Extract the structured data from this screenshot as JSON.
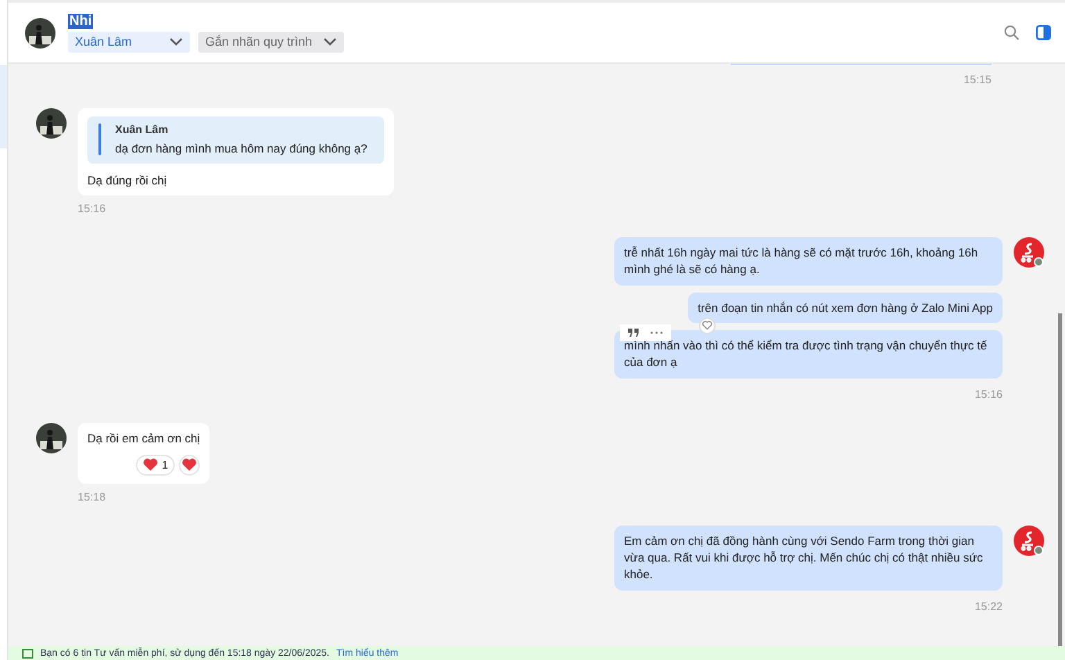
{
  "header": {
    "name": "Nhi",
    "assignee": "Xuân Lâm",
    "tag_placeholder": "Gắn nhãn quy trình"
  },
  "messages": [
    {
      "kind": "partial",
      "time": "15:15"
    },
    {
      "kind": "incoming",
      "quote": {
        "author": "Xuân Lâm",
        "text": "dạ đơn hàng mình mua hôm nay đúng không ạ?"
      },
      "bubbles": [
        "Dạ đúng rồi chị"
      ],
      "time": "15:16"
    },
    {
      "kind": "outgoing",
      "bubbles": [
        "trễ nhất 16h ngày mai tức là hàng sẽ có mặt trước 16h, khoảng 16h mình ghé là sẽ có hàng ạ.",
        "trên đoạn tin nhắn có nút xem đơn hàng ở Zalo Mini App",
        "mình nhấn vào thì có thể kiểm tra được tình trạng vận chuyển thực tế của đơn ạ"
      ],
      "time": "15:16"
    },
    {
      "kind": "incoming",
      "bubbles": [
        "Dạ rồi em cảm ơn chị"
      ],
      "reaction_count": "1",
      "time": "15:18"
    },
    {
      "kind": "outgoing",
      "bubbles": [
        "Em cảm ơn chị đã đồng hành cùng với Sendo Farm trong thời gian vừa qua. Rất vui khi được hỗ trợ chị. Mến chúc chị có thật nhiều sức khỏe."
      ],
      "time": "15:22"
    }
  ],
  "banner": {
    "text": "Bạn có 6 tin Tư vấn miễn phí, sử dụng đến 15:18 ngày 22/06/2025.",
    "link": "Tìm hiểu thêm"
  }
}
